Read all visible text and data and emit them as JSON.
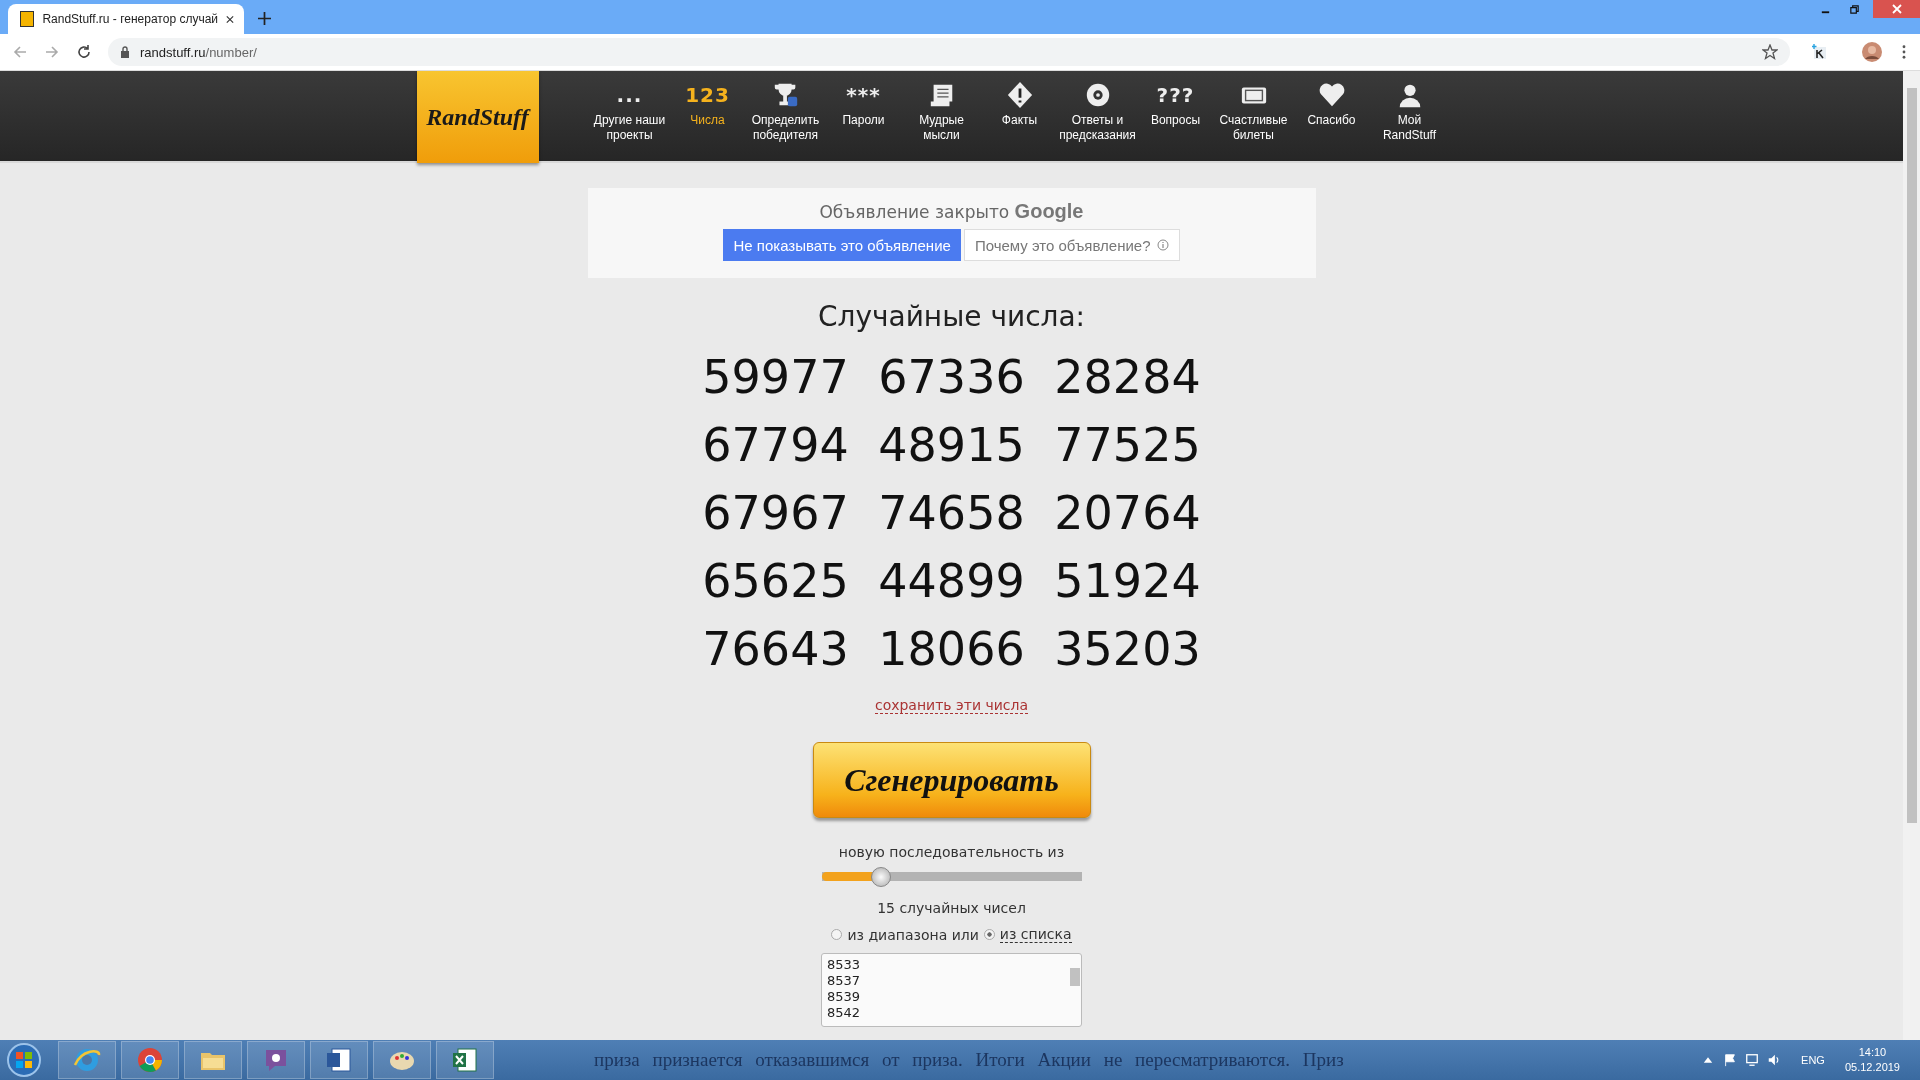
{
  "browser": {
    "tab_title": "RandStuff.ru - генератор случай",
    "url_host": "randstuff.ru",
    "url_path": "/number/"
  },
  "nav": {
    "logo": "RandStuff",
    "items": [
      {
        "label": "Другие наши проекты",
        "glyph": "...",
        "selected": false
      },
      {
        "label": "Числа",
        "glyph": "123",
        "selected": true
      },
      {
        "label": "Определить победителя",
        "selected": false
      },
      {
        "label": "Пароли",
        "glyph": "***",
        "selected": false
      },
      {
        "label": "Мудрые мысли",
        "selected": false
      },
      {
        "label": "Факты",
        "selected": false
      },
      {
        "label": "Ответы и предсказания",
        "selected": false
      },
      {
        "label": "Вопросы",
        "glyph": "???",
        "selected": false
      },
      {
        "label": "Счастливые билеты",
        "selected": false
      },
      {
        "label": "Спасибо",
        "selected": false
      },
      {
        "label": "Мой RandStuff",
        "selected": false
      }
    ]
  },
  "ad": {
    "closed_text": "Объявление закрыто",
    "brand": "Google",
    "hide_button": "Не показывать это объявление",
    "why_button": "Почему это объявление?"
  },
  "heading": "Случайные числа:",
  "numbers": [
    [
      "59977",
      "67336",
      "28284"
    ],
    [
      "67794",
      "48915",
      "77525"
    ],
    [
      "67967",
      "74658",
      "20764"
    ],
    [
      "65625",
      "44899",
      "51924"
    ],
    [
      "76643",
      "18066",
      "35203"
    ]
  ],
  "save_link": "сохранить эти числа",
  "generate_button": "Сгенерировать",
  "slider": {
    "label": "новую последовательность из",
    "level": 0.23,
    "reading": "15 случайных чисел"
  },
  "sources": [
    {
      "label": "из диапазона или",
      "kind": "plain",
      "selected": false
    },
    {
      "label": "из списка",
      "kind": "link",
      "selected": true
    }
  ],
  "list_values": [
    "8533",
    "8537",
    "8539",
    "8542"
  ],
  "taskbar": {
    "overlay_text": "приза признается отказавшимся от приза. Итоги Акции не пересматриваются. Приз",
    "language": "ENG",
    "time": "14:10",
    "date": "05.12.2019"
  }
}
